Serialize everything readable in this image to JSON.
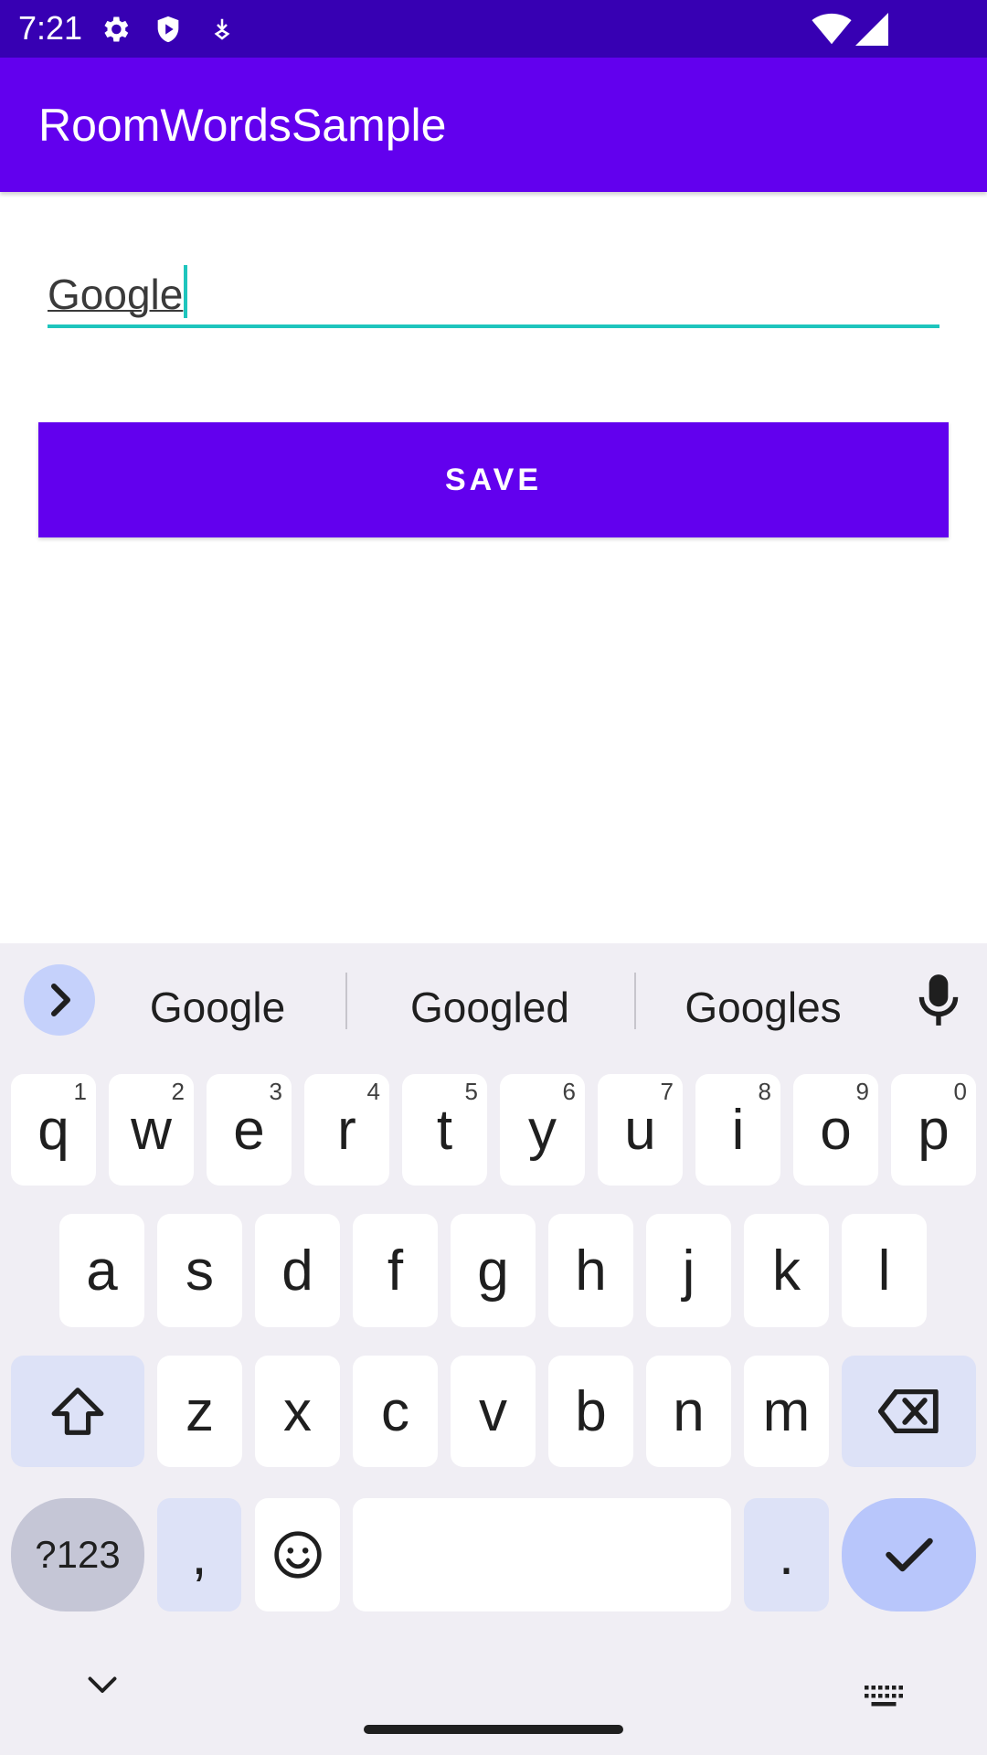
{
  "status_bar": {
    "time": "7:21",
    "icons": [
      "gear-icon",
      "shield-icon",
      "download-icon",
      "wifi-icon",
      "cell-signal-icon"
    ]
  },
  "app_bar": {
    "title": "RoomWordsSample"
  },
  "word_input": {
    "value": "Google"
  },
  "save_button": {
    "label": "SAVE"
  },
  "keyboard": {
    "suggestions": [
      "Google",
      "Googled",
      "Googles"
    ],
    "row1": [
      {
        "k": "q",
        "h": "1"
      },
      {
        "k": "w",
        "h": "2"
      },
      {
        "k": "e",
        "h": "3"
      },
      {
        "k": "r",
        "h": "4"
      },
      {
        "k": "t",
        "h": "5"
      },
      {
        "k": "y",
        "h": "6"
      },
      {
        "k": "u",
        "h": "7"
      },
      {
        "k": "i",
        "h": "8"
      },
      {
        "k": "o",
        "h": "9"
      },
      {
        "k": "p",
        "h": "0"
      }
    ],
    "row2": [
      "a",
      "s",
      "d",
      "f",
      "g",
      "h",
      "j",
      "k",
      "l"
    ],
    "row3": [
      "z",
      "x",
      "c",
      "v",
      "b",
      "n",
      "m"
    ],
    "symbols_label": "?123",
    "comma": ",",
    "period": "."
  },
  "colors": {
    "status_bar": "#3700b3",
    "primary": "#6200ee",
    "accent": "#1ec5bd"
  }
}
